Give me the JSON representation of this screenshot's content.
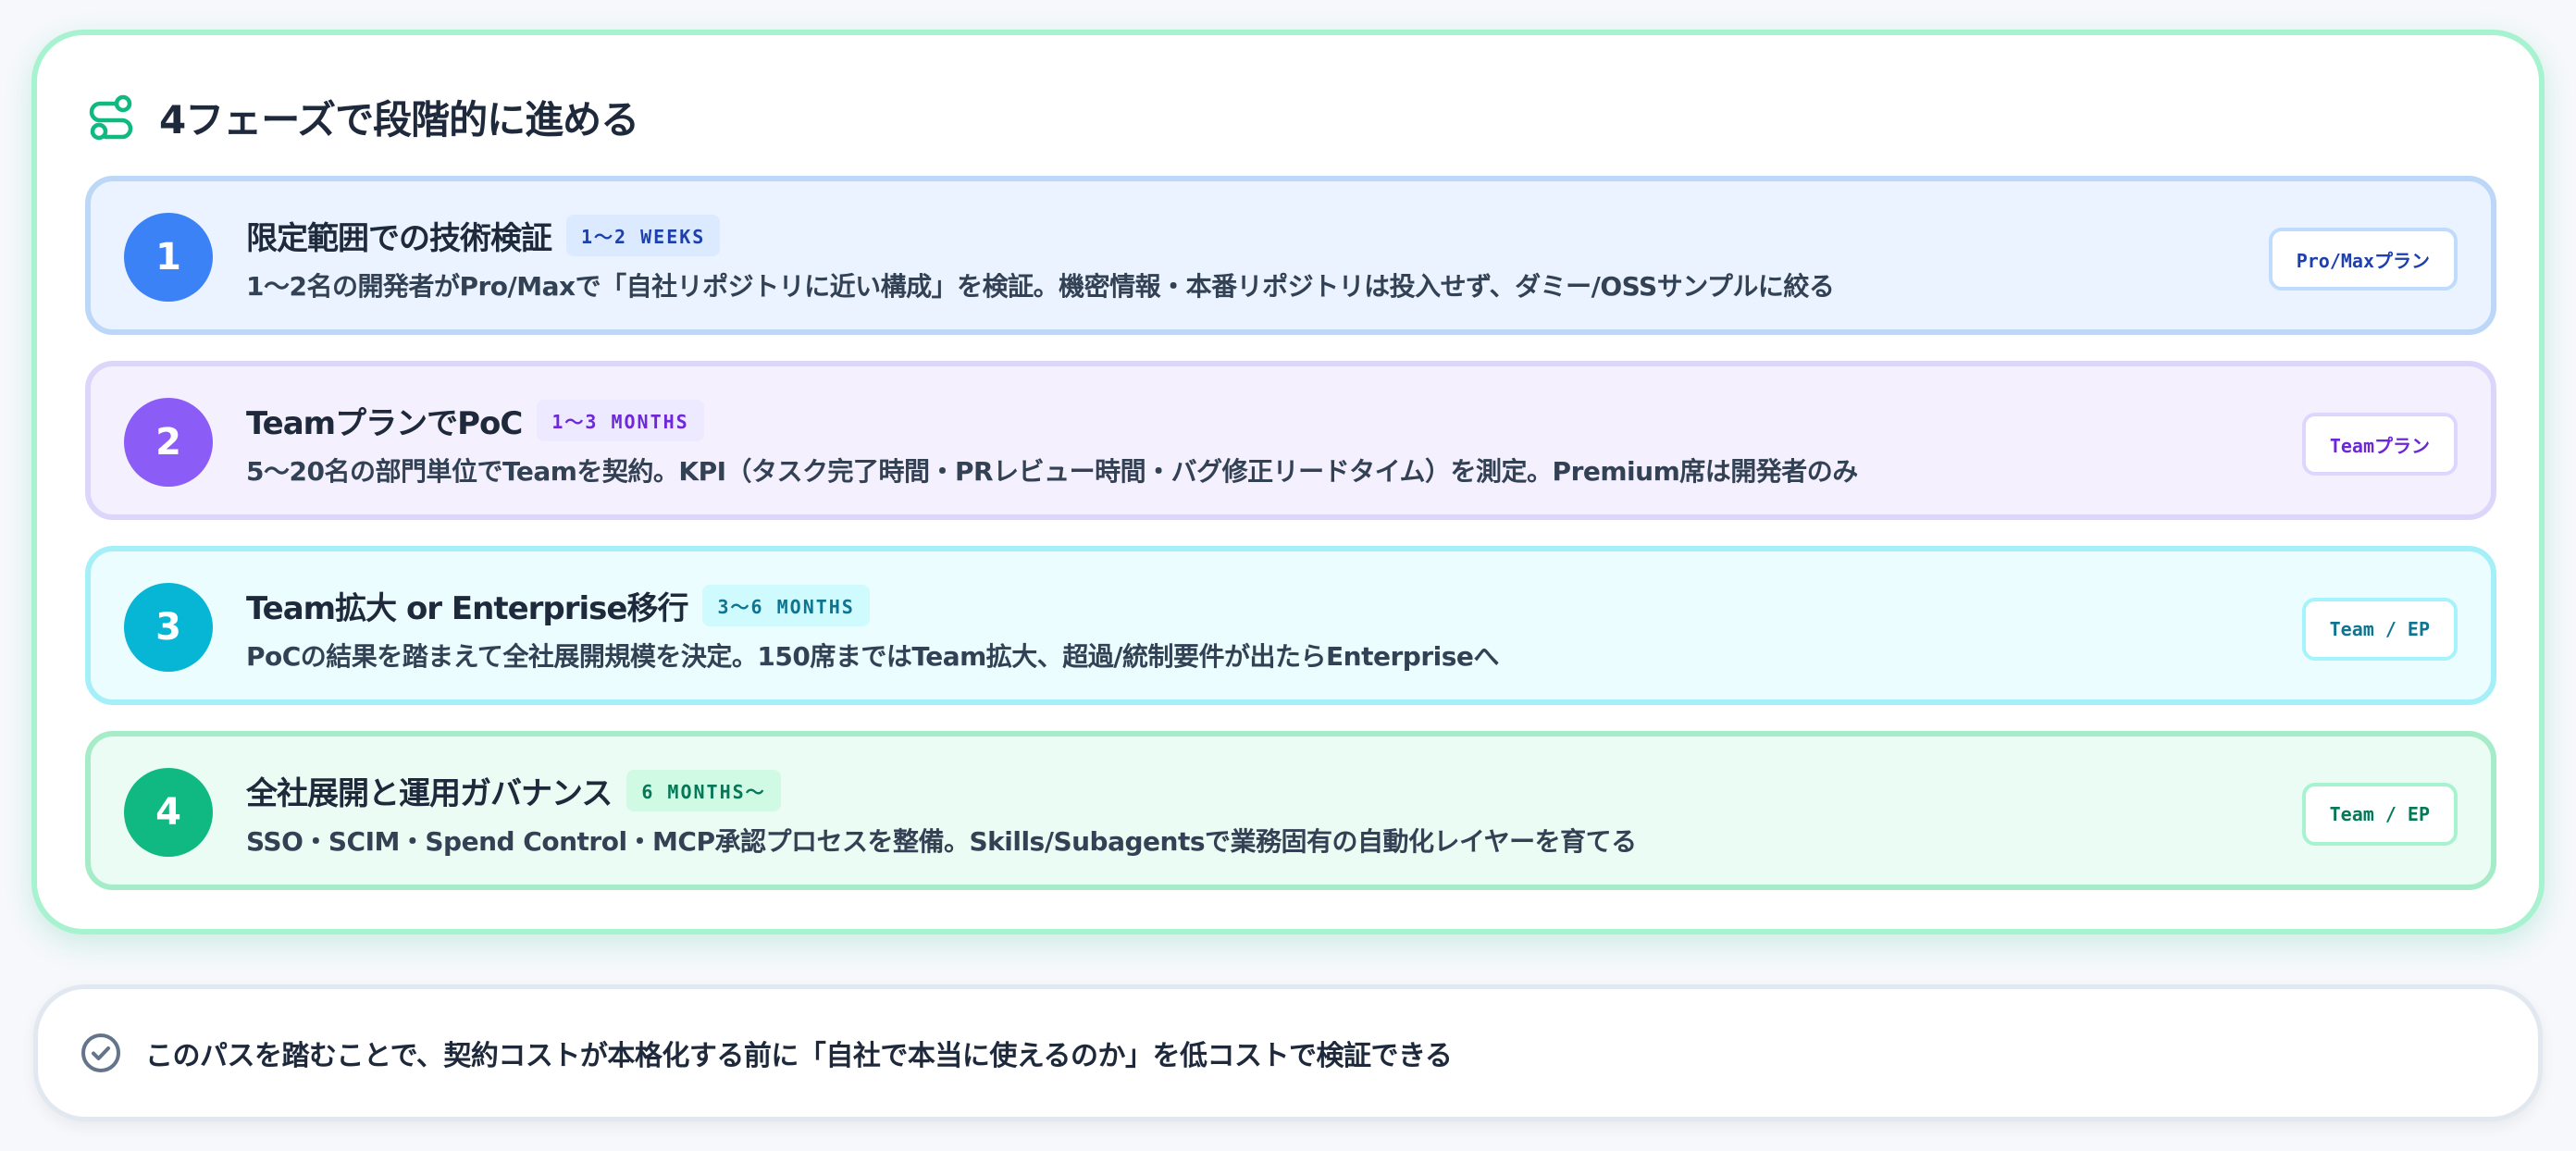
{
  "header": {
    "title": "4フェーズで段階的に進める",
    "icon": "route-icon",
    "accent_color": "#10b981"
  },
  "phases": [
    {
      "number": "1",
      "title": "限定範囲での技術検証",
      "duration": "1〜2 WEEKS",
      "description": "1〜2名の開発者がPro/Maxで「自社リポジトリに近い構成」を検証。機密情報・本番リポジトリは投入せず、ダミー/OSSサンプルに絞る",
      "plan": "Pro/Maxプラン",
      "color": "#3b82f6"
    },
    {
      "number": "2",
      "title": "TeamプランでPoC",
      "duration": "1〜3 MONTHS",
      "description": "5〜20名の部門単位でTeamを契約。KPI（タスク完了時間・PRレビュー時間・バグ修正リードタイム）を測定。Premium席は開発者のみ",
      "plan": "Teamプラン",
      "color": "#8b5cf6"
    },
    {
      "number": "3",
      "title": "Team拡大 or Enterprise移行",
      "duration": "3〜6 MONTHS",
      "description": "PoCの結果を踏まえて全社展開規模を決定。150席まではTeam拡大、超過/統制要件が出たらEnterpriseへ",
      "plan": "Team / EP",
      "color": "#06b6d4"
    },
    {
      "number": "4",
      "title": "全社展開と運用ガバナンス",
      "duration": "6 MONTHS〜",
      "description": "SSO・SCIM・Spend Control・MCP承認プロセスを整備。Skills/Subagentsで業務固有の自動化レイヤーを育てる",
      "plan": "Team / EP",
      "color": "#10b981"
    }
  ],
  "note": {
    "icon": "check-circle-icon",
    "text": "このパスを踏むことで、契約コストが本格化する前に「自社で本当に使えるのか」を低コストで検証できる"
  }
}
